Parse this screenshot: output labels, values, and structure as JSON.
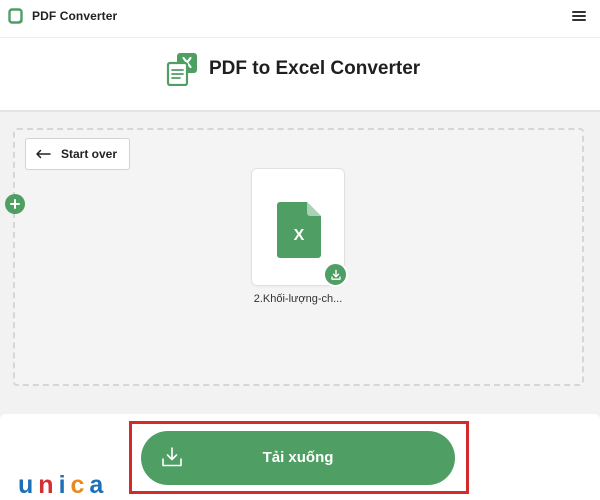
{
  "app": {
    "name": "PDF Converter",
    "menu_icon": "hamburger-menu-icon"
  },
  "header": {
    "title": "PDF to Excel Converter",
    "icon": "pdf-to-excel-icon"
  },
  "workspace": {
    "start_over_label": "Start over",
    "add_file_icon": "plus-icon",
    "file": {
      "name": "2.Khối-lượng-ch...",
      "type_letter": "X",
      "icon": "excel-file-icon",
      "download_icon": "download-icon"
    }
  },
  "download_button": {
    "label": "Tải xuống",
    "icon": "download-tray-icon"
  },
  "watermark": {
    "letters": [
      "u",
      "n",
      "i",
      "c",
      "a"
    ]
  },
  "colors": {
    "brand_green": "#4f9e64",
    "highlight_red": "#d32b2b",
    "watermark_blue": "#1d6fb8",
    "watermark_red": "#d62e31",
    "watermark_orange": "#e88a1c"
  }
}
